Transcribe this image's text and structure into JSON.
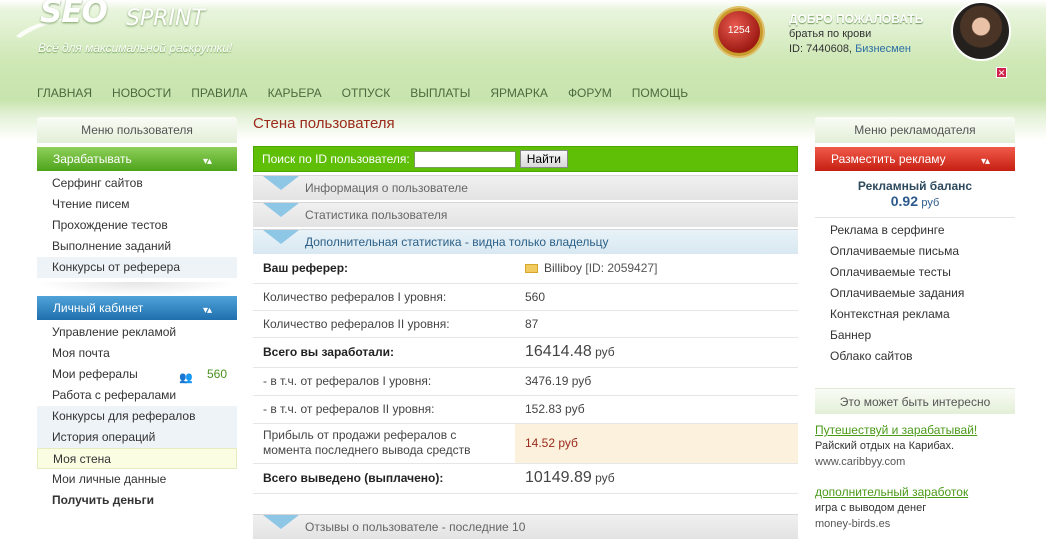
{
  "header": {
    "logo_main": "SEO",
    "logo_sub": "SPRINT",
    "tagline": "Всё для максимальной раскрутки!",
    "medal_value": "1254",
    "welcome": "ДОБРО ПОЖАЛОВАТЬ",
    "user_name": "братья по крови",
    "user_id": "ID: 7440608,",
    "status": "Бизнесмен",
    "close": "✕"
  },
  "nav": [
    "ГЛАВНАЯ",
    "НОВОСТИ",
    "ПРАВИЛА",
    "КАРЬЕРА",
    "ОТПУСК",
    "ВЫПЛАТЫ",
    "ЯРМАРКА",
    "ФОРУМ",
    "ПОМОЩЬ"
  ],
  "left": {
    "title": "Меню пользователя",
    "earn": {
      "title": "Зарабатывать",
      "items": [
        "Серфинг сайтов",
        "Чтение писем",
        "Прохождение тестов",
        "Выполнение заданий",
        "Конкурсы от реферера"
      ]
    },
    "cabinet": {
      "title": "Личный кабинет",
      "items": [
        "Управление рекламой",
        "Моя почта",
        "Мои рефералы",
        "Работа с рефералами",
        "Конкурсы для рефералов",
        "История операций",
        "Моя стена",
        "Мои личные данные",
        "Получить деньги"
      ],
      "referrals_count": "560"
    }
  },
  "main": {
    "title": "Стена пользователя",
    "search_label": "Поиск по ID пользователя:",
    "search_value": "",
    "search_button": "Найти",
    "sections": [
      "Информация о пользователе",
      "Статистика пользователя",
      "Дополнительная статистика - видна только владельцу",
      "Отзывы о пользователе - последние 10"
    ],
    "rows": [
      {
        "k": "Ваш реферер:",
        "v": "Billiboy",
        "v2": "[ID: 2059427]"
      },
      {
        "k": "Количество рефералов I уровня:",
        "v": "560"
      },
      {
        "k": "Количество рефералов II уровня:",
        "v": "87"
      },
      {
        "k": "Всего вы заработали:",
        "v": "16414.48",
        "u": "руб"
      },
      {
        "k": "- в т.ч. от рефералов I уровня:",
        "v": "3476.19 руб"
      },
      {
        "k": "- в т.ч. от рефералов II уровня:",
        "v": "152.83 руб"
      },
      {
        "k1": "Прибыль от продажи рефералов с",
        "k2": "момента последнего вывода средств",
        "v": "14.52 руб"
      },
      {
        "k": "Всего выведено (выплачено):",
        "v": "10149.89",
        "u": "руб"
      }
    ]
  },
  "right": {
    "title": "Меню рекламодателя",
    "place": "Разместить рекламу",
    "balance_title": "Рекламный баланс",
    "balance_value": "0.92",
    "balance_cur": "руб",
    "items": [
      "Реклама в серфинге",
      "Оплачиваемые письма",
      "Оплачиваемые тесты",
      "Оплачиваемые задания",
      "Контекстная реклама",
      "Баннер",
      "Облако сайтов"
    ],
    "interesting": "Это может быть интересно",
    "ads": [
      {
        "t": "Путешествуй и зарабатывай!",
        "d": "Райский отдых на Карибах.",
        "u": "www.caribbyy.com"
      },
      {
        "t": "дополнительный заработок",
        "d": "игра с выводом денег",
        "u": "money-birds.es"
      }
    ]
  }
}
